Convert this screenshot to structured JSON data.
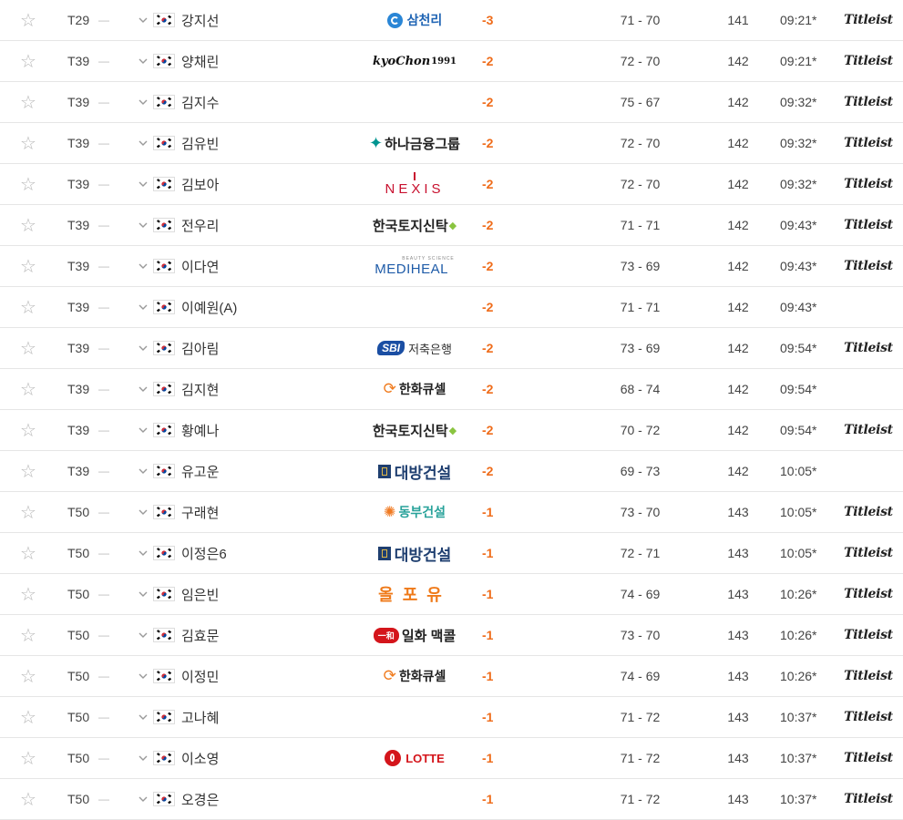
{
  "icons": {
    "favorite": "star-outline-icon",
    "expand": "chevron-down-icon",
    "flag": "korea-flag-icon"
  },
  "colors": {
    "score": "#ef6c1a",
    "divider": "#e6e6e6"
  },
  "players": [
    {
      "rank": "T29",
      "move": "—",
      "name": "강지선",
      "sponsor": "samchully",
      "sponsor_text": "삼천리",
      "score": "-3",
      "rounds": "71 - 70",
      "total": "141",
      "tee": "09:21*",
      "ball": "Titleist"
    },
    {
      "rank": "T39",
      "move": "—",
      "name": "양채린",
      "sponsor": "kyochon",
      "sponsor_text": "kyoChon",
      "sponsor_sup": "1991",
      "score": "-2",
      "rounds": "72 - 70",
      "total": "142",
      "tee": "09:21*",
      "ball": "Titleist"
    },
    {
      "rank": "T39",
      "move": "—",
      "name": "김지수",
      "sponsor": "",
      "sponsor_text": "",
      "score": "-2",
      "rounds": "75 - 67",
      "total": "142",
      "tee": "09:32*",
      "ball": "Titleist"
    },
    {
      "rank": "T39",
      "move": "—",
      "name": "김유빈",
      "sponsor": "hana",
      "sponsor_text": "하나금융그룹",
      "score": "-2",
      "rounds": "72 - 70",
      "total": "142",
      "tee": "09:32*",
      "ball": "Titleist"
    },
    {
      "rank": "T39",
      "move": "—",
      "name": "김보아",
      "sponsor": "nexis",
      "sponsor_text": "NEXIS",
      "score": "-2",
      "rounds": "72 - 70",
      "total": "142",
      "tee": "09:32*",
      "ball": "Titleist"
    },
    {
      "rank": "T39",
      "move": "—",
      "name": "전우리",
      "sponsor": "kt",
      "sponsor_text": "한국토지신탁",
      "score": "-2",
      "rounds": "71 - 71",
      "total": "142",
      "tee": "09:43*",
      "ball": "Titleist"
    },
    {
      "rank": "T39",
      "move": "—",
      "name": "이다연",
      "sponsor": "mediheal",
      "sponsor_text": "MEDIHEAL",
      "sponsor_top": "BEAUTY SCIENCE",
      "score": "-2",
      "rounds": "73 - 69",
      "total": "142",
      "tee": "09:43*",
      "ball": "Titleist"
    },
    {
      "rank": "T39",
      "move": "—",
      "name": "이예원(A)",
      "sponsor": "",
      "sponsor_text": "",
      "score": "-2",
      "rounds": "71 - 71",
      "total": "142",
      "tee": "09:43*",
      "ball": ""
    },
    {
      "rank": "T39",
      "move": "—",
      "name": "김아림",
      "sponsor": "sbi",
      "sponsor_text": "저축은행",
      "sponsor_mark": "SBI",
      "score": "-2",
      "rounds": "73 - 69",
      "total": "142",
      "tee": "09:54*",
      "ball": "Titleist"
    },
    {
      "rank": "T39",
      "move": "—",
      "name": "김지현",
      "sponsor": "hanwha",
      "sponsor_text": "한화큐셀",
      "score": "-2",
      "rounds": "68 - 74",
      "total": "142",
      "tee": "09:54*",
      "ball": ""
    },
    {
      "rank": "T39",
      "move": "—",
      "name": "황예나",
      "sponsor": "kt",
      "sponsor_text": "한국토지신탁",
      "score": "-2",
      "rounds": "70 - 72",
      "total": "142",
      "tee": "09:54*",
      "ball": "Titleist"
    },
    {
      "rank": "T39",
      "move": "—",
      "name": "유고운",
      "sponsor": "daebang",
      "sponsor_text": "대방건설",
      "score": "-2",
      "rounds": "69 - 73",
      "total": "142",
      "tee": "10:05*",
      "ball": ""
    },
    {
      "rank": "T50",
      "move": "—",
      "name": "구래현",
      "sponsor": "dongbu",
      "sponsor_text": "동부건설",
      "score": "-1",
      "rounds": "73 - 70",
      "total": "143",
      "tee": "10:05*",
      "ball": "Titleist"
    },
    {
      "rank": "T50",
      "move": "—",
      "name": "이정은6",
      "sponsor": "daebang",
      "sponsor_text": "대방건설",
      "score": "-1",
      "rounds": "72 - 71",
      "total": "143",
      "tee": "10:05*",
      "ball": "Titleist"
    },
    {
      "rank": "T50",
      "move": "—",
      "name": "임은빈",
      "sponsor": "allpoyu",
      "sponsor_text": "올포유",
      "score": "-1",
      "rounds": "74 - 69",
      "total": "143",
      "tee": "10:26*",
      "ball": "Titleist"
    },
    {
      "rank": "T50",
      "move": "—",
      "name": "김효문",
      "sponsor": "ilhwa",
      "sponsor_text": "일화 맥콜",
      "sponsor_mark": "一和",
      "score": "-1",
      "rounds": "73 - 70",
      "total": "143",
      "tee": "10:26*",
      "ball": "Titleist"
    },
    {
      "rank": "T50",
      "move": "—",
      "name": "이정민",
      "sponsor": "hanwha",
      "sponsor_text": "한화큐셀",
      "score": "-1",
      "rounds": "74 - 69",
      "total": "143",
      "tee": "10:26*",
      "ball": "Titleist"
    },
    {
      "rank": "T50",
      "move": "—",
      "name": "고나혜",
      "sponsor": "",
      "sponsor_text": "",
      "score": "-1",
      "rounds": "71 - 72",
      "total": "143",
      "tee": "10:37*",
      "ball": "Titleist"
    },
    {
      "rank": "T50",
      "move": "—",
      "name": "이소영",
      "sponsor": "lotte",
      "sponsor_text": "LOTTE",
      "score": "-1",
      "rounds": "71 - 72",
      "total": "143",
      "tee": "10:37*",
      "ball": "Titleist"
    },
    {
      "rank": "T50",
      "move": "—",
      "name": "오경은",
      "sponsor": "",
      "sponsor_text": "",
      "score": "-1",
      "rounds": "71 - 72",
      "total": "143",
      "tee": "10:37*",
      "ball": "Titleist"
    }
  ]
}
